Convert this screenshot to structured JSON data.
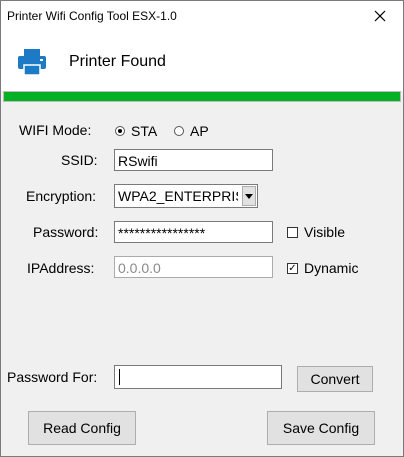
{
  "window": {
    "title": "Printer Wifi Config Tool ESX-1.0",
    "close_glyph": "✕"
  },
  "header": {
    "title": "Printer Found",
    "icon": "printer-icon",
    "progress_fraction": 1.0,
    "progress_color": "#06b025"
  },
  "form": {
    "wifi_mode": {
      "label": "WIFI Mode:",
      "options": [
        "STA",
        "AP"
      ],
      "selected": "STA"
    },
    "ssid": {
      "label": "SSID:",
      "value": "RSwifi"
    },
    "encryption": {
      "label": "Encryption:",
      "value": "WPA2_ENTERPRIS"
    },
    "password": {
      "label": "Password:",
      "value": "****************",
      "visible_label": "Visible",
      "visible_checked": false
    },
    "ipaddress": {
      "label": "IPAddress:",
      "value": "0.0.0.0",
      "dynamic_label": "Dynamic",
      "dynamic_checked": true,
      "dynamic_mark": "✓"
    },
    "password_for": {
      "label": "Password For:",
      "value": ""
    }
  },
  "buttons": {
    "convert": "Convert",
    "read_config": "Read Config",
    "save_config": "Save Config"
  }
}
